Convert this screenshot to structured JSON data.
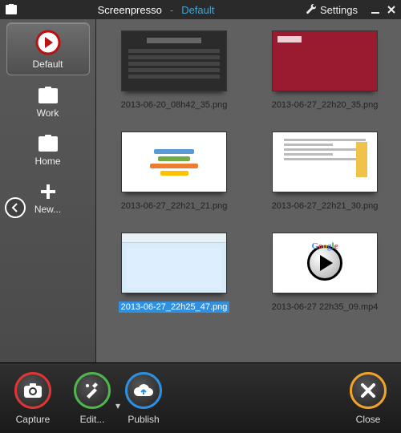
{
  "titlebar": {
    "app_name": "Screenpresso",
    "separator": "-",
    "workspace": "Default",
    "settings_label": "Settings"
  },
  "sidebar": {
    "items": [
      {
        "id": "default",
        "label": "Default",
        "selected": true,
        "icon": "logo"
      },
      {
        "id": "work",
        "label": "Work",
        "selected": false,
        "icon": "folder"
      },
      {
        "id": "home",
        "label": "Home",
        "selected": false,
        "icon": "folder"
      },
      {
        "id": "new",
        "label": "New...",
        "selected": false,
        "icon": "plus"
      }
    ]
  },
  "thumbnails": [
    {
      "filename": "2013-06-20_08h42_35.png",
      "kind": "table",
      "selected": false
    },
    {
      "filename": "2013-06-27_22h20_35.png",
      "kind": "webred",
      "selected": false
    },
    {
      "filename": "2013-06-27_22h21_21.png",
      "kind": "bars",
      "selected": false
    },
    {
      "filename": "2013-06-27_22h21_30.png",
      "kind": "doc",
      "selected": false
    },
    {
      "filename": "2013-06-27_22h25_47.png",
      "kind": "browser",
      "selected": true
    },
    {
      "filename": "2013-06-27 22h35_09.mp4",
      "kind": "video",
      "selected": false
    }
  ],
  "toolbar": {
    "capture_label": "Capture",
    "edit_label": "Edit...",
    "publish_label": "Publish",
    "close_label": "Close"
  },
  "colors": {
    "accent": "#3ea6d6",
    "capture": "#e03535",
    "edit": "#4fb64d",
    "publish": "#2f8fe0",
    "close": "#f0a328",
    "selection": "#2f8fe0"
  }
}
